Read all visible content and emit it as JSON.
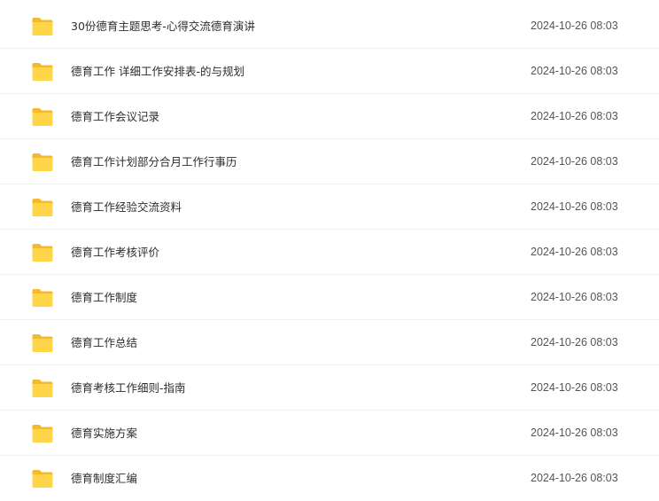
{
  "colors": {
    "folder_back": "#F5B92B",
    "folder_front": "#FFD54A",
    "divider": "#F2F2F2",
    "name_text": "#2D2D2D",
    "date_text": "#555555"
  },
  "folder_icon": "folder-icon",
  "files": [
    {
      "name": "30份德育主题思考-心得交流德育演讲",
      "date": "2024-10-26 08:03"
    },
    {
      "name": "德育工作 详细工作安排表-的与规划",
      "date": "2024-10-26 08:03"
    },
    {
      "name": "德育工作会议记录",
      "date": "2024-10-26 08:03"
    },
    {
      "name": "德育工作计划部分合月工作行事历",
      "date": "2024-10-26 08:03"
    },
    {
      "name": "德育工作经验交流资料",
      "date": "2024-10-26 08:03"
    },
    {
      "name": "德育工作考核评价",
      "date": "2024-10-26 08:03"
    },
    {
      "name": "德育工作制度",
      "date": "2024-10-26 08:03"
    },
    {
      "name": "德育工作总结",
      "date": "2024-10-26 08:03"
    },
    {
      "name": "德育考核工作细则-指南",
      "date": "2024-10-26 08:03"
    },
    {
      "name": "德育实施方案",
      "date": "2024-10-26 08:03"
    },
    {
      "name": "德育制度汇编",
      "date": "2024-10-26 08:03"
    }
  ]
}
